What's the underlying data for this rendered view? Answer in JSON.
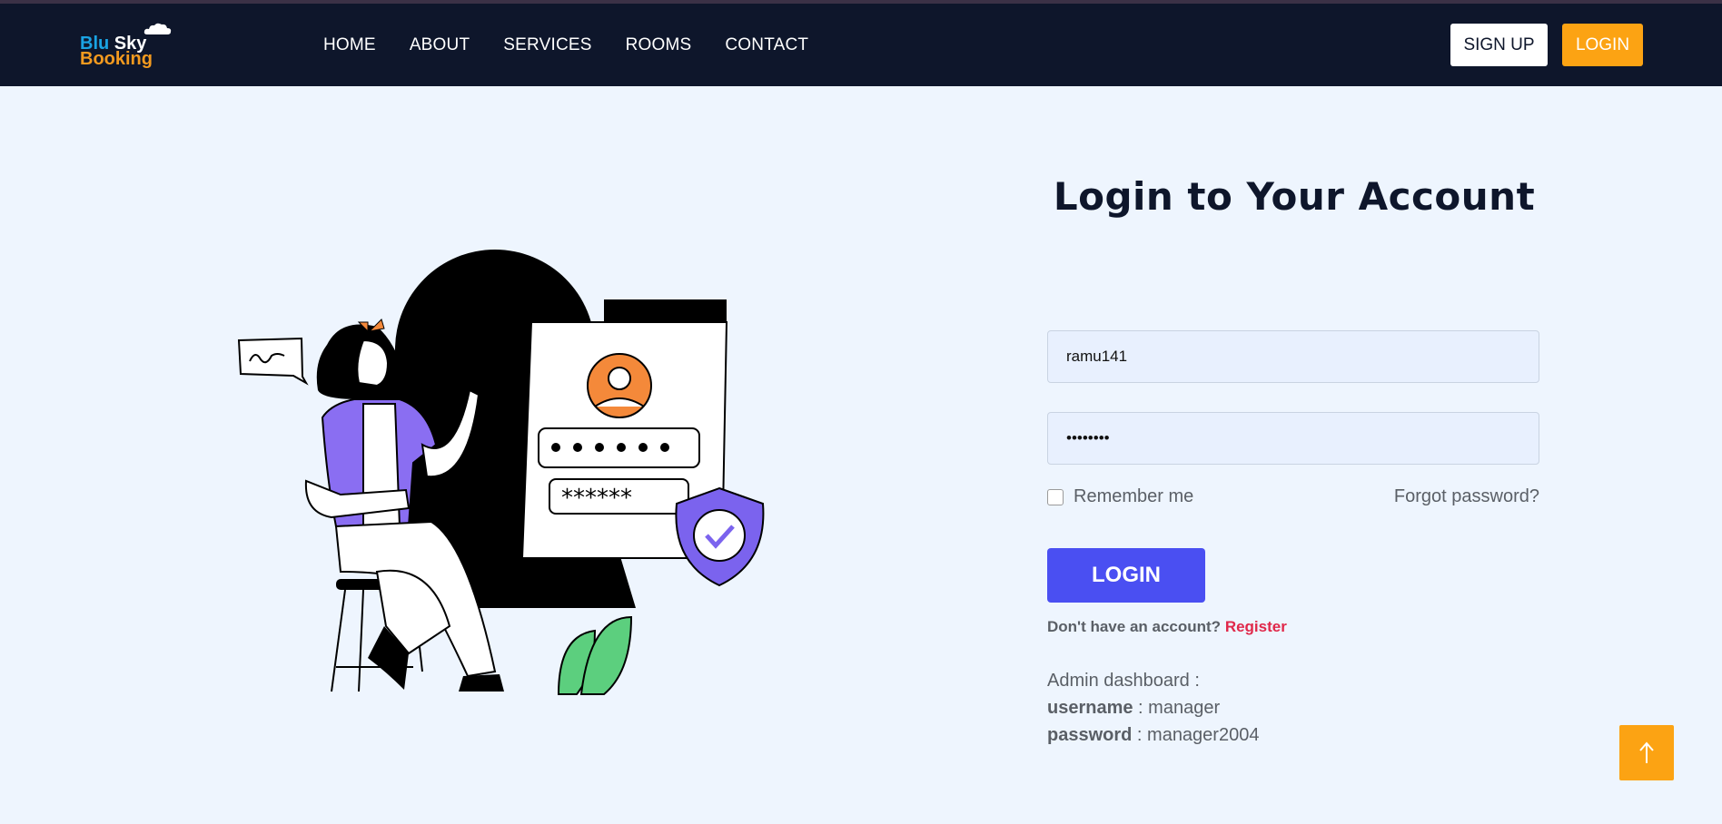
{
  "brand": {
    "line1_a": "Blu",
    "line1_b": "Sky",
    "line2": "Booking"
  },
  "nav": {
    "items": [
      "HOME",
      "ABOUT",
      "SERVICES",
      "ROOMS",
      "CONTACT"
    ]
  },
  "header": {
    "signup_label": "SIGN UP",
    "login_label": "LOGIN"
  },
  "form": {
    "title": "Login to Your Account",
    "username_value": "ramu141",
    "password_value": "••••••••",
    "remember_label": "Remember me",
    "forgot_label": "Forgot password?",
    "submit_label": "LOGIN",
    "no_account_text": "Don't have an account?",
    "register_label": "Register"
  },
  "admin": {
    "heading": "Admin dashboard :",
    "username_key": "username",
    "username_value": " : manager",
    "password_key": "password",
    "password_value": " : manager2004"
  },
  "colors": {
    "navbar": "#0e162b",
    "accent": "#fca313",
    "primary": "#4a4ff2",
    "link": "#e0284a",
    "background": "#eef5fe"
  },
  "icons": [
    "cloud-icon",
    "arrow-up-icon",
    "login-illustration"
  ]
}
